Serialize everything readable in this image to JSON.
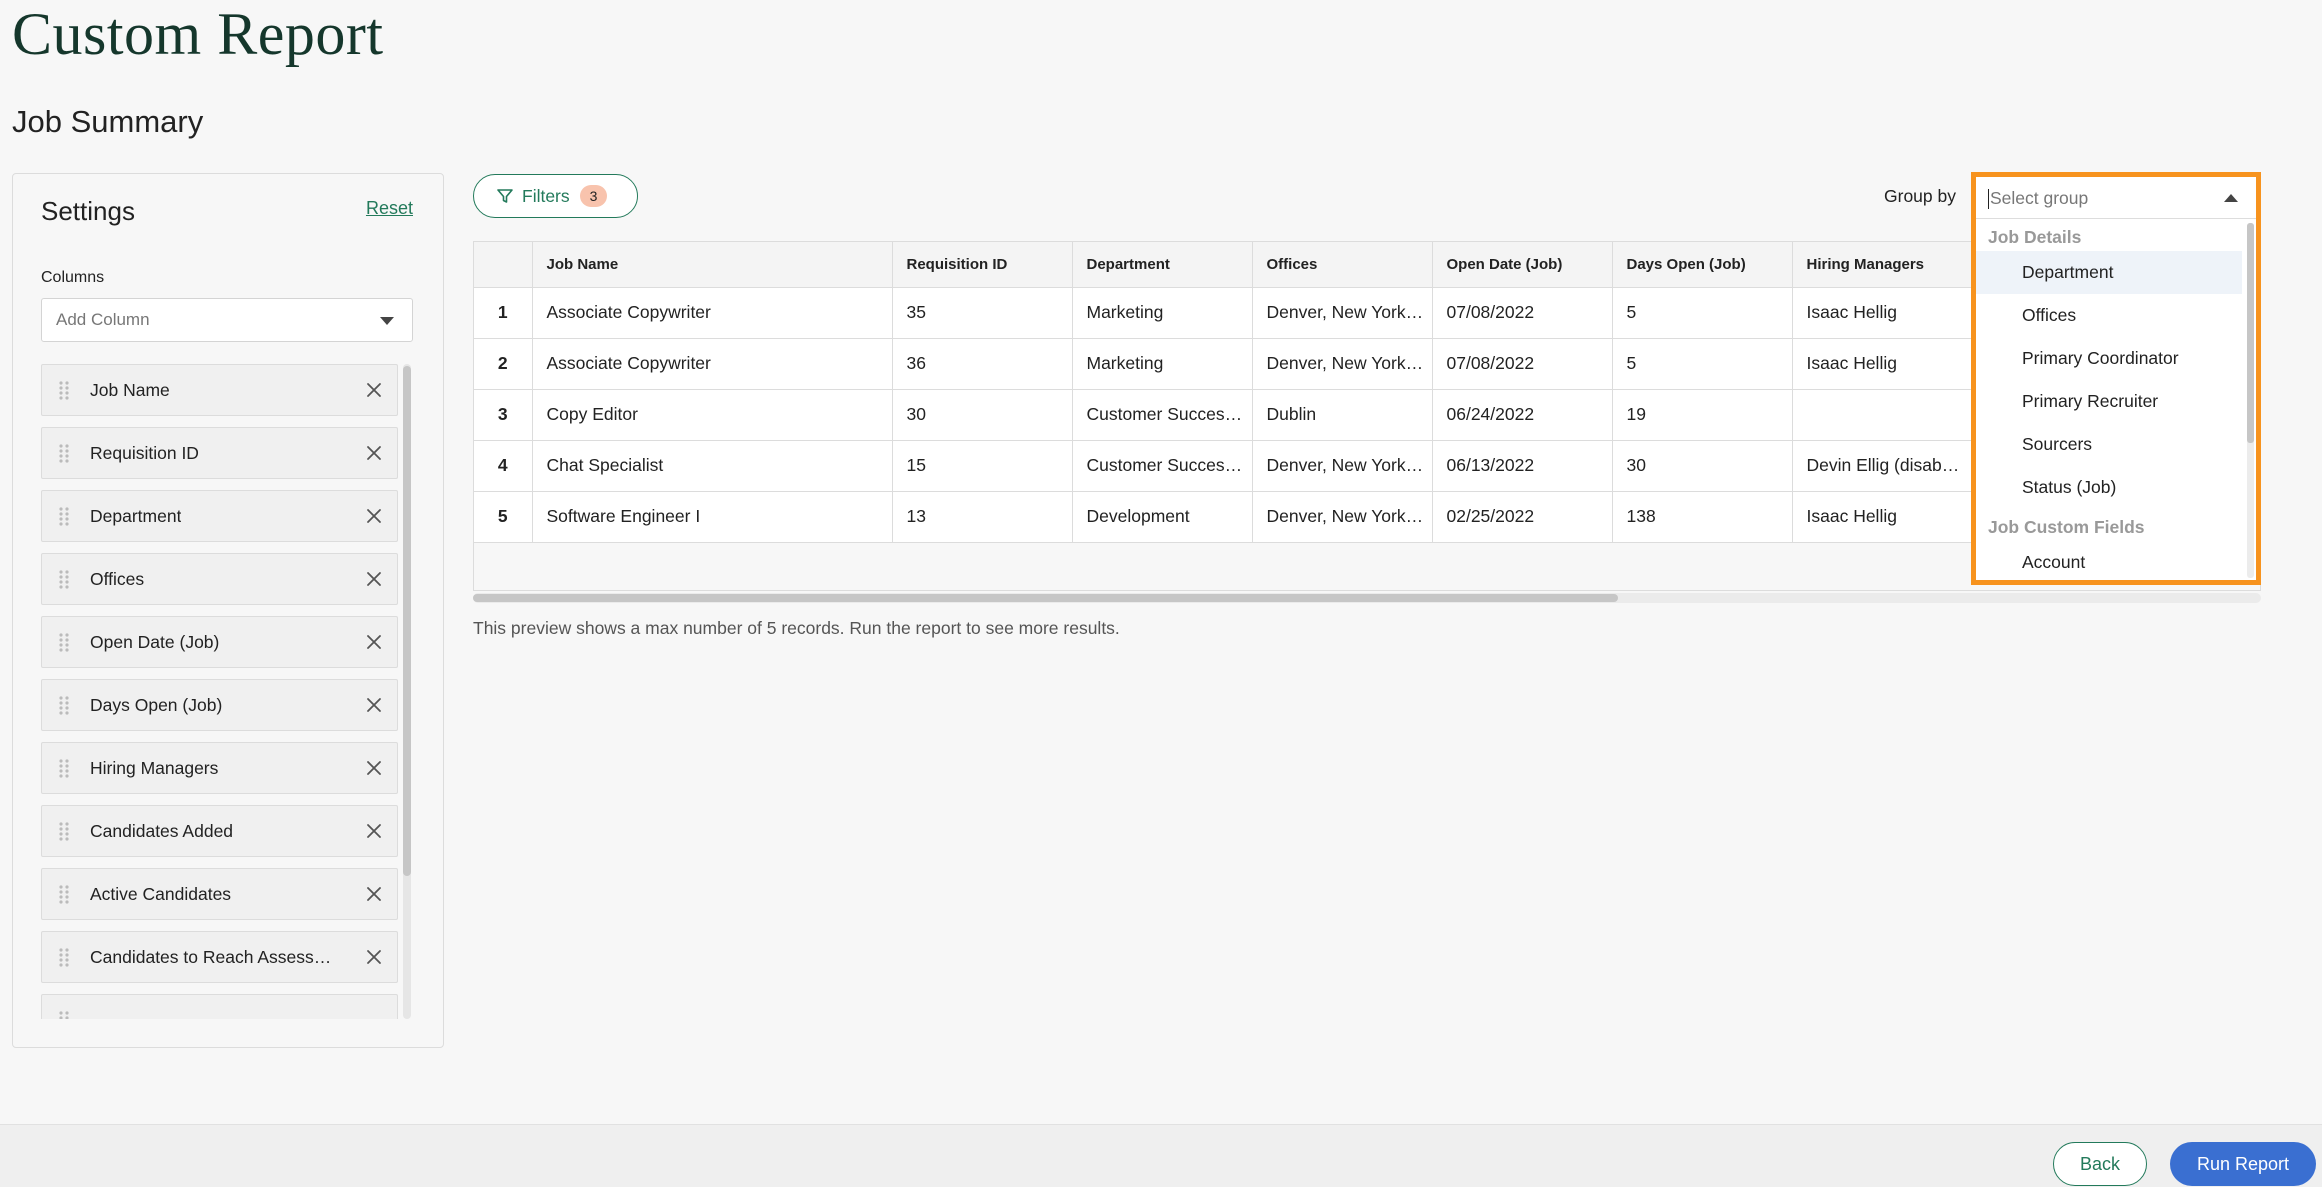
{
  "page": {
    "title": "Custom Report",
    "report_name": "Job Summary"
  },
  "settings": {
    "title": "Settings",
    "reset_label": "Reset",
    "columns_label": "Columns",
    "add_column_placeholder": "Add Column",
    "columns": [
      "Job Name",
      "Requisition ID",
      "Department",
      "Offices",
      "Open Date (Job)",
      "Days Open (Job)",
      "Hiring Managers",
      "Candidates Added",
      "Active Candidates",
      "Candidates to Reach Assess…",
      ""
    ]
  },
  "toolbar": {
    "filters_label": "Filters",
    "filters_count": "3",
    "group_by_label": "Group by"
  },
  "table": {
    "headers": [
      "",
      "Job Name",
      "Requisition ID",
      "Department",
      "Offices",
      "Open Date (Job)",
      "Days Open (Job)",
      "Hiring Managers"
    ],
    "rows": [
      [
        "1",
        "Associate Copywriter",
        "35",
        "Marketing",
        "Denver, New York…",
        "07/08/2022",
        "5",
        "Isaac Hellig"
      ],
      [
        "2",
        "Associate Copywriter",
        "36",
        "Marketing",
        "Denver, New York…",
        "07/08/2022",
        "5",
        "Isaac Hellig"
      ],
      [
        "3",
        "Copy Editor",
        "30",
        "Customer Succes…",
        "Dublin",
        "06/24/2022",
        "19",
        ""
      ],
      [
        "4",
        "Chat Specialist",
        "15",
        "Customer Succes…",
        "Denver, New York…",
        "06/13/2022",
        "30",
        "Devin Ellig (disab…"
      ],
      [
        "5",
        "Software Engineer I",
        "13",
        "Development",
        "Denver, New York…",
        "02/25/2022",
        "138",
        "Isaac Hellig"
      ]
    ]
  },
  "preview_note": "This preview shows a max number of 5 records. Run the report to see more results.",
  "group_by": {
    "placeholder": "Select group",
    "groups": [
      {
        "label": "Job Details",
        "options": [
          "Department",
          "Offices",
          "Primary Coordinator",
          "Primary Recruiter",
          "Sourcers",
          "Status (Job)"
        ]
      },
      {
        "label": "Job Custom Fields",
        "options": [
          "Account"
        ]
      }
    ],
    "highlighted": "Department"
  },
  "footer": {
    "back_label": "Back",
    "run_label": "Run Report"
  },
  "colors": {
    "brand_green": "#237a5b",
    "title_green": "#15372c",
    "highlight_orange": "#f7931e",
    "run_blue": "#3a6fd1"
  }
}
